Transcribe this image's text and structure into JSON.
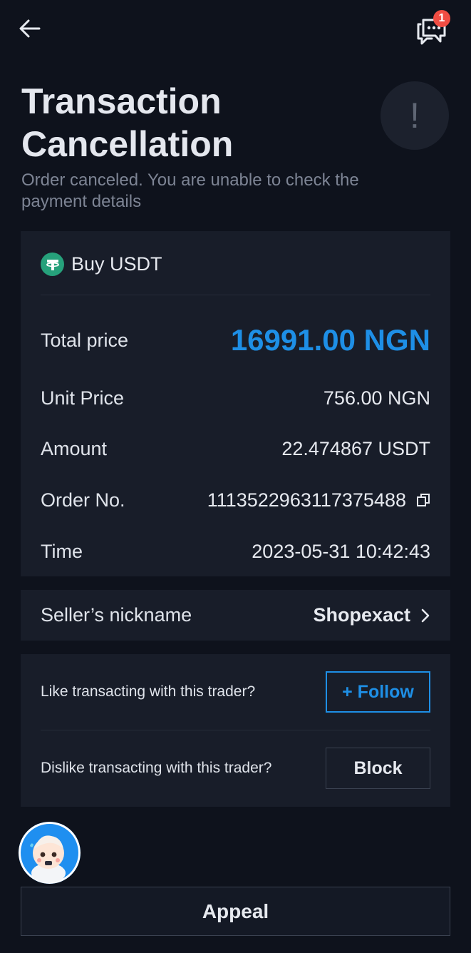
{
  "header": {
    "back_icon": "arrow-left-icon",
    "chat_icon": "chat-bubbles-icon",
    "chat_badge": "1"
  },
  "title": "Transaction Cancellation",
  "subtitle": "Order canceled. You are unable to check the payment details",
  "status_icon": "exclamation-icon",
  "status_symbol": "!",
  "order": {
    "coin_icon": "tether-icon",
    "heading": "Buy USDT",
    "total_price_label": "Total price",
    "total_price_value": "16991.00 NGN",
    "unit_price_label": "Unit Price",
    "unit_price_value": "756.00 NGN",
    "amount_label": "Amount",
    "amount_value": "22.474867 USDT",
    "order_no_label": "Order No.",
    "order_no_value": "1113522963117375488",
    "time_label": "Time",
    "time_value": "2023-05-31 10:42:43"
  },
  "seller": {
    "label": "Seller’s nickname",
    "value": "Shopexact"
  },
  "trader": {
    "like_question": "Like transacting with this trader?",
    "follow_label": "+ Follow",
    "dislike_question": "Dislike transacting with this trader?",
    "block_label": "Block"
  },
  "appeal_label": "Appeal",
  "colors": {
    "background": "#0e121c",
    "card": "#181d29",
    "accent_blue": "#1e8fe6",
    "badge_red": "#f04d43",
    "tether_green": "#26a17b"
  }
}
